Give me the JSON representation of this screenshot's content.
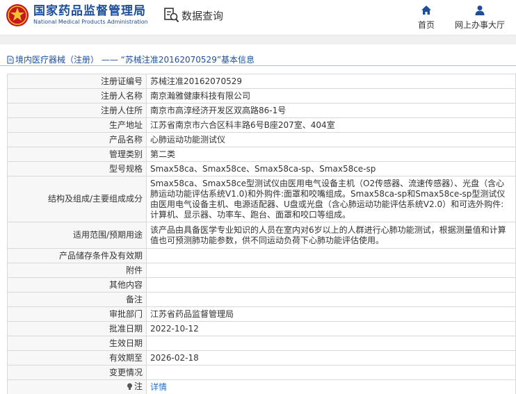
{
  "header": {
    "logo_cn": "国家药品监督管理局",
    "logo_en": "National Medical Products Administration",
    "query_label": "数据查询",
    "nav_home": "首页",
    "nav_hall": "网上办事大厅"
  },
  "colors": {
    "brand_blue": "#1d4f9b",
    "emblem_red": "#c8161d",
    "emblem_gold": "#f2c230",
    "link": "#2a6fc9"
  },
  "detail": {
    "title": "境内医疗器械（注册） —— “苏械注准20162070529”基本信息"
  },
  "rows": [
    {
      "label": "注册证编号",
      "value": "苏械注准20162070529"
    },
    {
      "label": "注册人名称",
      "value": "南京瀚雅健康科技有限公司"
    },
    {
      "label": "注册人住所",
      "value": "南京市高淳经济开发区双高路86-1号"
    },
    {
      "label": "生产地址",
      "value": "江苏省南京市六合区科丰路6号B座207室、404室"
    },
    {
      "label": "产品名称",
      "value": "心肺运动功能测试仪"
    },
    {
      "label": "管理类别",
      "value": "第二类"
    },
    {
      "label": "型号规格",
      "value": "Smax58ca、Smax58ce、Smax58ca-sp、Smax58ce-sp"
    },
    {
      "label": "结构及组成/主要组成成分",
      "value": "Smax58ca、Smax58ce型测试仪由医用电气设备主机（O2传感器、流速传感器）、光盘（含心肺运动功能评估系统V1.0)和外购件:面罩和咬嘴组成。Smax58ca-sp和Smax58ce-sp型测试仪由医用电气设备主机、电源适配器、U盘或光盘（含心肺运动功能评估系统V2.0）和可选外购件:计算机、显示器、功率车、跑台、面罩和咬口等组成。"
    },
    {
      "label": "适用范围/预期用途",
      "value": "该产品由具备医学专业知识的人员在室内对6岁以上的人群进行心肺功能测试，根据测量值和计算值也可预测肺功能参数，供不同运动负荷下心肺功能评估使用。"
    },
    {
      "label": "产品储存条件及有效期",
      "value": ""
    },
    {
      "label": "附件",
      "value": ""
    },
    {
      "label": "其他内容",
      "value": ""
    },
    {
      "label": "备注",
      "value": ""
    },
    {
      "label": "审批部门",
      "value": "江苏省药品监督管理局"
    },
    {
      "label": "批准日期",
      "value": "2022-10-12"
    },
    {
      "label": "生效日期",
      "value": ""
    },
    {
      "label": "有效期至",
      "value": "2026-02-18"
    },
    {
      "label": "变更情况",
      "value": ""
    },
    {
      "label": "注",
      "value": "详情"
    }
  ]
}
